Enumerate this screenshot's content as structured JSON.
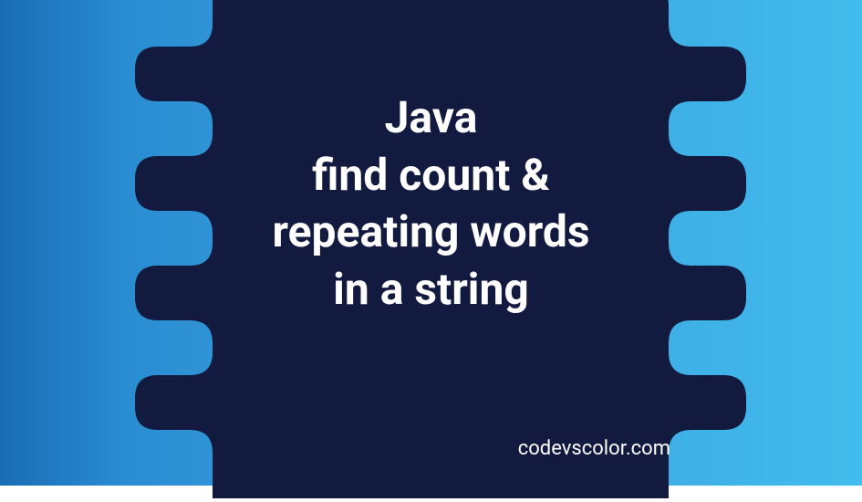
{
  "title": {
    "line1": "Java",
    "line2": "find count &",
    "line3": "repeating words",
    "line4": "in a string"
  },
  "watermark": "codevscolor.com",
  "colors": {
    "blob": "#131a40",
    "text": "#ffffff",
    "gradient_start": "#1a6db5",
    "gradient_end": "#42bdec"
  }
}
